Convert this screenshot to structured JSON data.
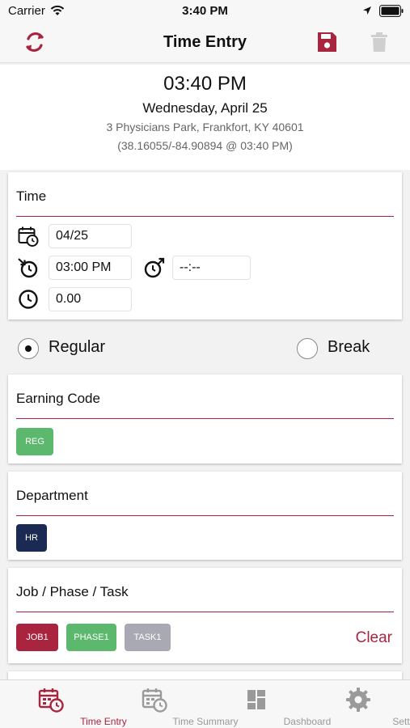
{
  "status_bar": {
    "carrier": "Carrier",
    "time": "3:40 PM"
  },
  "nav": {
    "title": "Time Entry"
  },
  "header": {
    "clock": "03:40 PM",
    "date": "Wednesday, April 25",
    "address": "3 Physicians Park, Frankfort, KY 40601",
    "coordinates": "(38.16055/-84.90894 @ 03:40 PM)"
  },
  "time_card": {
    "title": "Time",
    "date_value": "04/25",
    "start_value": "03:00 PM",
    "end_value": "--:--",
    "hours_value": "0.00"
  },
  "entry_type": {
    "options": [
      {
        "label": "Regular",
        "selected": true
      },
      {
        "label": "Break",
        "selected": false
      }
    ]
  },
  "earning_code": {
    "title": "Earning Code",
    "chip": "REG"
  },
  "department": {
    "title": "Department",
    "chip": "HR"
  },
  "job": {
    "title": "Job / Phase / Task",
    "chips": [
      "JOB1",
      "PHASE1",
      "TASK1"
    ],
    "clear_label": "Clear"
  },
  "tabs": [
    {
      "label": "Time Entry",
      "icon": "calendar-clock-icon",
      "active": true
    },
    {
      "label": "Time Summary",
      "icon": "calendar-clock-icon",
      "active": false
    },
    {
      "label": "Dashboard",
      "icon": "dashboard-icon",
      "active": false
    },
    {
      "label": "Settings",
      "icon": "gear-icon",
      "active": false
    }
  ],
  "colors": {
    "accent": "#a8243f",
    "chip_green": "#5cb86d",
    "chip_navy": "#1a2a52",
    "chip_grey": "#a9a9b3"
  }
}
